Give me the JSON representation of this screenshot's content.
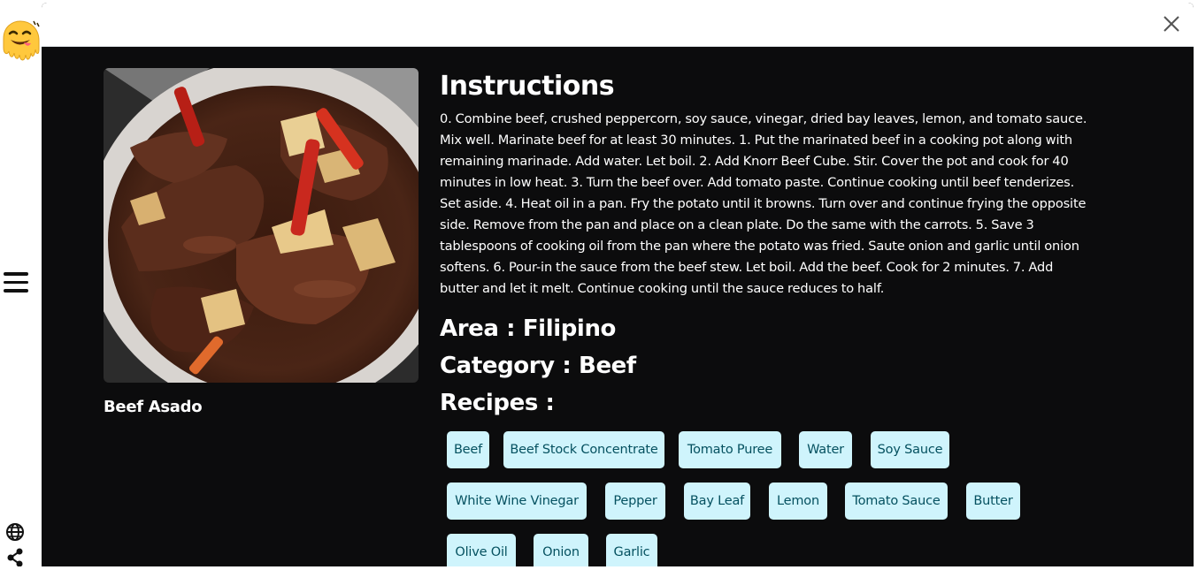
{
  "meal": {
    "name": "Beef Asado",
    "instructions_title": "Instructions",
    "instructions": "0. Combine beef, crushed peppercorn, soy sauce, vinegar, dried bay leaves, lemon, and tomato sauce. Mix well. Marinate beef for at least 30 minutes. 1. Put the marinated beef in a cooking pot along with remaining marinade. Add water. Let boil. 2. Add Knorr Beef Cube. Stir. Cover the pot and cook for 40 minutes in low heat. 3. Turn the beef over. Add tomato paste. Continue cooking until beef tenderizes. Set aside. 4. Heat oil in a pan. Fry the potato until it browns. Turn over and continue frying the opposite side. Remove from the pan and place on a clean plate. Do the same with the carrots. 5. Save 3 tablespoons of cooking oil from the pan where the potato was fried. Saute onion and garlic until onion softens. 6. Pour-in the sauce from the beef stew. Let boil. Add the beef. Cook for 2 minutes. 7. Add butter and let it melt. Continue cooking until the sauce reduces to half.",
    "area": "Area : Filipino",
    "category": "Category : Beef",
    "recipes_title": "Recipes :",
    "ingredients": [
      "Beef",
      "Beef Stock Concentrate",
      "Tomato Puree",
      "Water",
      "Soy Sauce",
      "White Wine Vinegar",
      "Pepper",
      "Bay Leaf",
      "Lemon",
      "Tomato Sauce",
      "Butter",
      "Olive Oil",
      "Onion",
      "Garlic"
    ]
  },
  "icons": {
    "logo": "smiling-face-logo-icon",
    "menu": "hamburger-menu-icon",
    "globe": "globe-icon",
    "share": "share-icon",
    "close": "close-icon"
  },
  "colors": {
    "modal_bg": "#0c0c0d",
    "chip_bg": "#cff4fc",
    "chip_text": "#055160",
    "logo_yellow": "#ffc83d"
  }
}
